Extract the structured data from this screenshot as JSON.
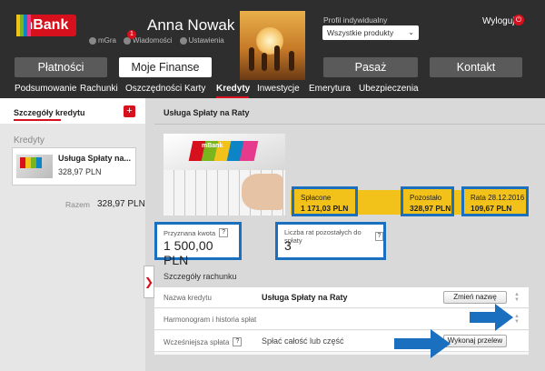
{
  "header": {
    "logo_text": "mBank",
    "user_name": "Anna Nowak",
    "links": [
      {
        "label": "mGra",
        "icon": "trophy-icon"
      },
      {
        "label": "Wiadomości",
        "icon": "envelope-icon",
        "badge": "1"
      },
      {
        "label": "Ustawienia",
        "icon": "gear-icon"
      }
    ],
    "profile_label": "Profil indywidualny",
    "profile_select": "Wszystkie produkty",
    "logout_label": "Wyloguj"
  },
  "main_nav": {
    "items": [
      "Płatności",
      "Moje Finanse",
      "Pasaż",
      "Kontakt"
    ],
    "active": "Moje Finanse"
  },
  "sub_nav": {
    "items": [
      "Podsumowanie",
      "Rachunki",
      "Oszczędności",
      "Karty",
      "Kredyty",
      "Inwestycje",
      "Emerytura",
      "Ubezpieczenia"
    ],
    "active": "Kredyty"
  },
  "left_panel": {
    "title": "Szczegóły kredytu",
    "add_label": "+",
    "section": "Kredyty",
    "card": {
      "name": "Usługa Spłaty na...",
      "amount": "328,97 PLN"
    },
    "total_label": "Razem",
    "total_value": "328,97 PLN"
  },
  "main": {
    "title": "Usługa Spłaty na Raty",
    "card_brand": "mBank",
    "stats": [
      {
        "label": "Spłacone",
        "value": "1 171,03 PLN"
      },
      {
        "label": "Pozostało",
        "value": "328,97 PLN"
      },
      {
        "label": "Rata 28.12.2016",
        "value": "109,67 PLN"
      }
    ],
    "granted": {
      "label": "Przyznana kwota",
      "value": "1 500,00 PLN",
      "help": "?"
    },
    "remaining_installments": {
      "label": "Liczba rat pozostałych do spłaty",
      "value": "3",
      "help": "?"
    },
    "details_title": "Szczegóły rachunku",
    "rows": [
      {
        "label": "Nazwa kredytu",
        "value": "Usługa Spłaty na Raty",
        "button": "Zmień nazwę"
      },
      {
        "label": "Harmonogram i historia spłat",
        "value": "",
        "button": ""
      },
      {
        "label": "Wcześniejsza spłata",
        "help": "?",
        "value": "Spłać całość lub część",
        "button": "Wykonaj przelew"
      }
    ]
  },
  "colors": {
    "brand_red": "#d6111d",
    "highlight_blue": "#1b6fbf",
    "yellow": "#f2c21a",
    "header_dark": "#2e2e2e"
  }
}
